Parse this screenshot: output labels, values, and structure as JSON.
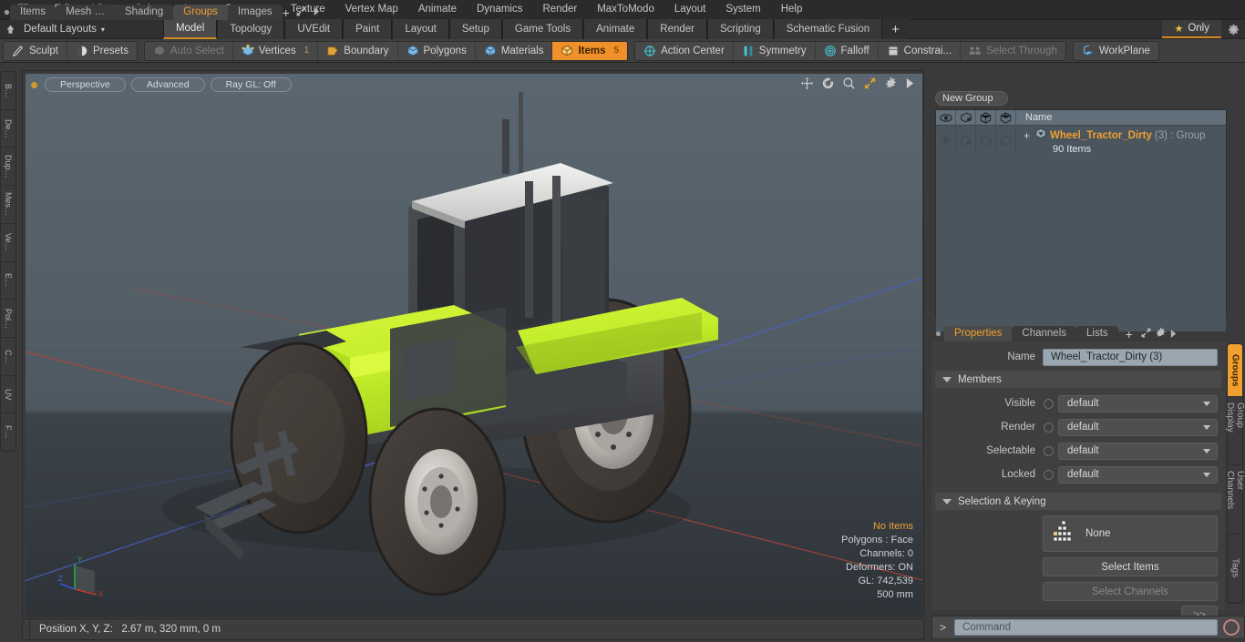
{
  "menu": {
    "items": [
      "File",
      "Edit",
      "View",
      "Select",
      "Item",
      "Geometry",
      "Texture",
      "Vertex Map",
      "Animate",
      "Dynamics",
      "Render",
      "MaxToModo",
      "Layout",
      "System",
      "Help"
    ]
  },
  "layoutbar": {
    "home_icon": "home-icon",
    "layout_name": "Default Layouts",
    "caret": "▾",
    "tabs": [
      {
        "label": "Model",
        "active": true
      },
      {
        "label": "Topology",
        "active": false
      },
      {
        "label": "UVEdit",
        "active": false
      },
      {
        "label": "Paint",
        "active": false
      },
      {
        "label": "Layout",
        "active": false
      },
      {
        "label": "Setup",
        "active": false
      },
      {
        "label": "Game Tools",
        "active": false
      },
      {
        "label": "Animate",
        "active": false
      },
      {
        "label": "Render",
        "active": false
      },
      {
        "label": "Scripting",
        "active": false
      },
      {
        "label": "Schematic Fusion",
        "active": false
      }
    ],
    "add_label": "+",
    "only_label": "Only",
    "star_glyph": "★",
    "gear_icon": "gear-icon"
  },
  "toolbar": {
    "group1": [
      {
        "label": "Sculpt",
        "icon": "sculpt-icon",
        "state": "normal",
        "count": ""
      },
      {
        "label": "Presets",
        "icon": "presets-icon",
        "state": "normal",
        "count": ""
      }
    ],
    "group2": [
      {
        "label": "Auto Select",
        "icon": "cube-icon",
        "state": "dim",
        "count": ""
      },
      {
        "label": "Vertices",
        "icon": "vertices-icon",
        "state": "normal",
        "count": "1"
      },
      {
        "label": "Boundary",
        "icon": "boundary-icon",
        "state": "normal",
        "count": ""
      },
      {
        "label": "Polygons",
        "icon": "polygons-icon",
        "state": "normal",
        "count": ""
      },
      {
        "label": "Materials",
        "icon": "materials-icon",
        "state": "normal",
        "count": ""
      },
      {
        "label": "Items",
        "icon": "items-icon",
        "state": "selected",
        "count": "5"
      }
    ],
    "group3": [
      {
        "label": "Action Center",
        "icon": "action-center-icon",
        "state": "normal",
        "count": ""
      },
      {
        "label": "Symmetry",
        "icon": "symmetry-icon",
        "state": "normal",
        "count": ""
      },
      {
        "label": "Falloff",
        "icon": "falloff-icon",
        "state": "normal",
        "count": ""
      },
      {
        "label": "Constrai...",
        "icon": "constraint-icon",
        "state": "normal",
        "count": ""
      },
      {
        "label": "Select Through",
        "icon": "select-through-icon",
        "state": "dim",
        "count": ""
      }
    ],
    "group4": [
      {
        "label": "WorkPlane",
        "icon": "workplane-icon",
        "state": "normal",
        "count": ""
      }
    ]
  },
  "left_rail": {
    "tabs": [
      "B…",
      "De…",
      "Dup…",
      "Mes…",
      "Ve…",
      "E…",
      "Pol…",
      "C…",
      "UV",
      "F…"
    ]
  },
  "viewport": {
    "mode_label": "Perspective",
    "shading_label": "Advanced",
    "raygl_label": "Ray GL: Off",
    "nav_icons": [
      "pan-icon",
      "rotate-icon",
      "zoom-icon",
      "fullscreen-icon",
      "viewport-gear-icon",
      "viewport-play-icon"
    ],
    "readout": {
      "items": "No Items",
      "polygons": "Polygons : Face",
      "channels": "Channels: 0",
      "deformers": "Deformers: ON",
      "gl": "GL: 742,539",
      "scale": "500 mm"
    },
    "gizmo": {
      "x_label": "X",
      "y_label": "Y",
      "z_label": "Z"
    },
    "model_name": "tractor-3d-model"
  },
  "statusbar": {
    "label": "Position X, Y, Z:",
    "value": "2.67 m, 320 mm, 0 m"
  },
  "right_panel": {
    "top_tabs": [
      {
        "label": "Items",
        "active": false
      },
      {
        "label": "Mesh …",
        "active": false
      },
      {
        "label": "Shading",
        "active": false
      },
      {
        "label": "Groups",
        "active": true
      },
      {
        "label": "Images",
        "active": false
      }
    ],
    "top_add": "+",
    "new_group_label": "New Group",
    "list": {
      "header_icons": [
        "eye-icon",
        "render-icon",
        "selectable-icon",
        "lock-icon"
      ],
      "name_header": "Name",
      "rows": [
        {
          "expander": "+",
          "icon": "group-item-icon",
          "name": "Wheel_Tractor_Dirty",
          "count": "(3) : Group",
          "sub": "90 Items"
        }
      ]
    },
    "properties": {
      "tabs": [
        {
          "label": "Properties",
          "active": true
        },
        {
          "label": "Channels",
          "active": false
        },
        {
          "label": "Lists",
          "active": false
        }
      ],
      "add": "+",
      "name_label": "Name",
      "name_value": "Wheel_Tractor_Dirty (3)",
      "members_header": "Members",
      "fields": [
        {
          "label": "Visible",
          "value": "default"
        },
        {
          "label": "Render",
          "value": "default"
        },
        {
          "label": "Selectable",
          "value": "default"
        },
        {
          "label": "Locked",
          "value": "default"
        }
      ],
      "selection_header": "Selection & Keying",
      "none_label": "None",
      "select_items_label": "Select Items",
      "select_channels_label": "Select Channels",
      "more_label": ">>"
    },
    "side_tabs": [
      {
        "label": "Groups",
        "active": true
      },
      {
        "label": "Group Display",
        "active": false
      },
      {
        "label": "User Channels",
        "active": false
      },
      {
        "label": "Tags",
        "active": false
      }
    ]
  },
  "command_bar": {
    "prompt": ">",
    "placeholder": "Command",
    "record_icon": "record-icon"
  },
  "colors": {
    "accent_orange": "#f0a030",
    "selected_orange": "#f0902a",
    "panel_bg": "#3a3a3a",
    "list_bg": "#4a555e",
    "model_green": "#c2ee2a",
    "axis_x": "#c0392b",
    "axis_y": "#27ae60",
    "axis_z": "#2f56c8"
  }
}
